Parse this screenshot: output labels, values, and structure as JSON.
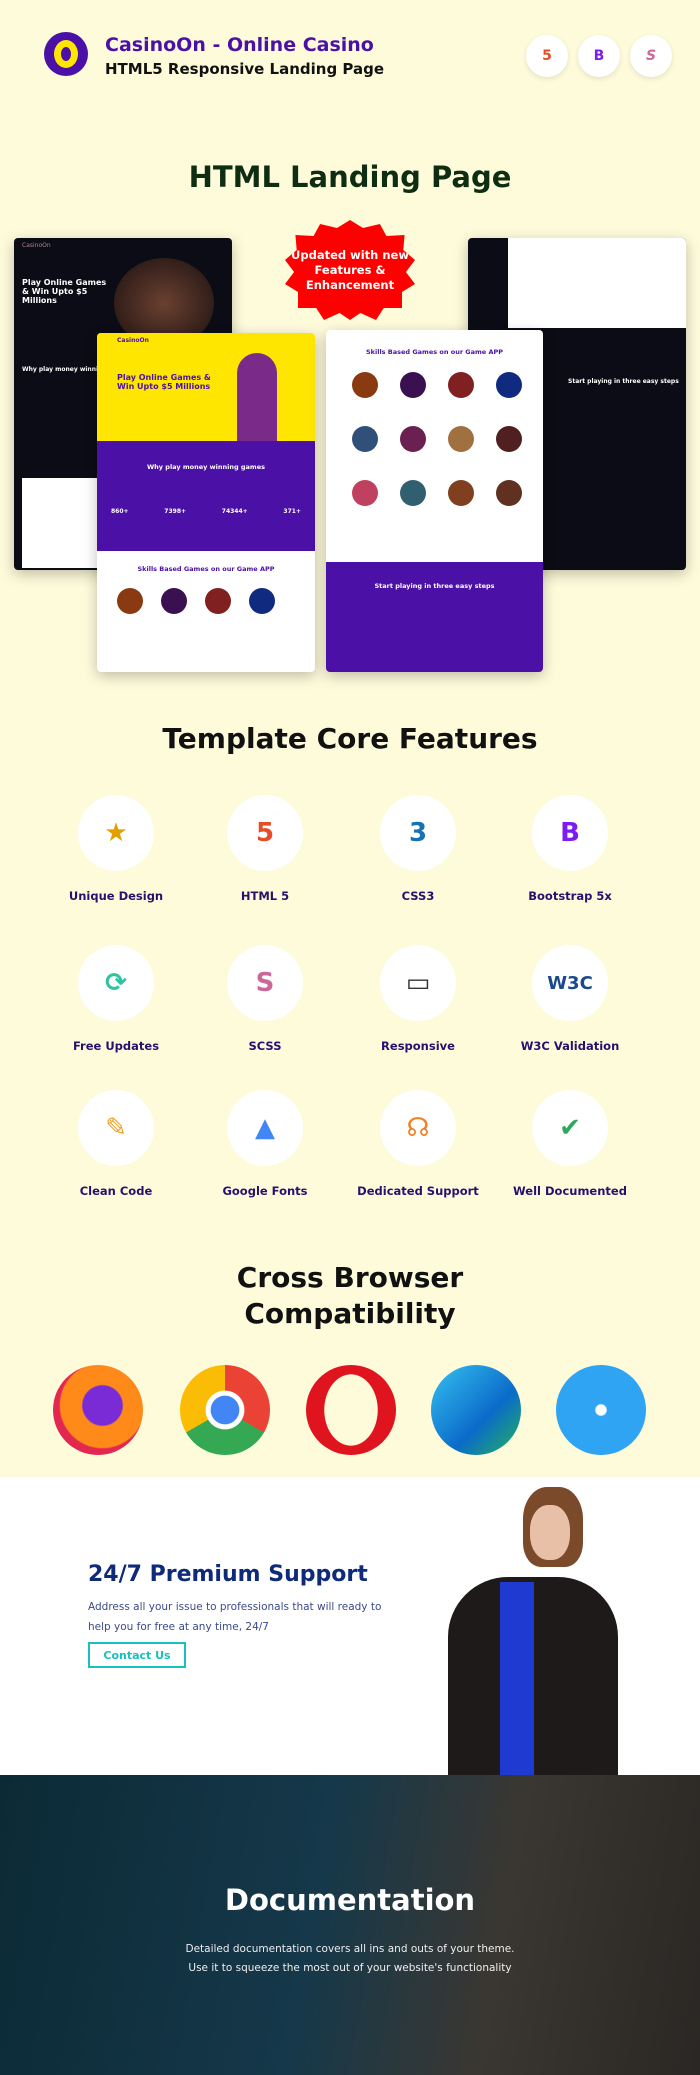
{
  "header": {
    "title": "CasinoOn - Online Casino",
    "subtitle": "HTML5 Responsive Landing Page",
    "tech_icons": [
      "html5-icon",
      "bootstrap-icon",
      "sass-icon"
    ]
  },
  "landing": {
    "title": "HTML Landing Page",
    "badge": "Updated with new Features & Enhancement",
    "mock_left": {
      "brand": "CasinoOn",
      "hero": "Play Online Games & Win Upto $5 Millions",
      "section": "Why play money winning games"
    },
    "mock_center": {
      "brand": "CasinoOn",
      "hero": "Play Online Games & Win Upto $5 Millions",
      "section": "Why play money winning games",
      "stats": [
        "860+",
        "7398+",
        "74344+",
        "371+"
      ],
      "games_title": "Skills Based Games on our Game APP"
    },
    "mock_right": {
      "games_title": "Skills Based Games on our Game APP",
      "steps_title": "Start playing in three easy steps"
    }
  },
  "features": {
    "title": "Template Core Features",
    "items": [
      {
        "label": "Unique Design",
        "icon": "unique-design-icon"
      },
      {
        "label": "HTML 5",
        "icon": "html5-icon"
      },
      {
        "label": "CSS3",
        "icon": "css3-icon"
      },
      {
        "label": "Bootstrap 5x",
        "icon": "bootstrap-icon"
      },
      {
        "label": "Free Updates",
        "icon": "free-updates-icon"
      },
      {
        "label": "SCSS",
        "icon": "sass-icon"
      },
      {
        "label": "Responsive",
        "icon": "responsive-icon"
      },
      {
        "label": "W3C Validation",
        "icon": "w3c-icon"
      },
      {
        "label": "Clean Code",
        "icon": "clean-code-icon"
      },
      {
        "label": "Google Fonts",
        "icon": "google-fonts-icon"
      },
      {
        "label": "Dedicated Support",
        "icon": "support-headset-icon"
      },
      {
        "label": "Well Documented",
        "icon": "documented-icon"
      }
    ]
  },
  "browsers": {
    "title_line1": "Cross Browser",
    "title_line2": "Compatibility",
    "items": [
      "firefox-icon",
      "chrome-icon",
      "opera-icon",
      "edge-icon",
      "safari-icon"
    ]
  },
  "support": {
    "title": "24/7 Premium Support",
    "text_line1": "Address all your issue to professionals that will ready to",
    "text_line2": "help you for free at any time, 24/7",
    "button": "Contact Us"
  },
  "documentation": {
    "title": "Documentation",
    "text_line1": "Detailed documentation covers all ins and outs of your theme.",
    "text_line2": "Use it to squeeze the most out of your website's functionality"
  },
  "colors": {
    "background": "#fefbdb",
    "brand_purple": "#4b10a6",
    "brand_yellow": "#ffe600",
    "support_blue": "#0f2a78",
    "contact_teal": "#18c1bd",
    "badge_red": "#ff0000"
  }
}
